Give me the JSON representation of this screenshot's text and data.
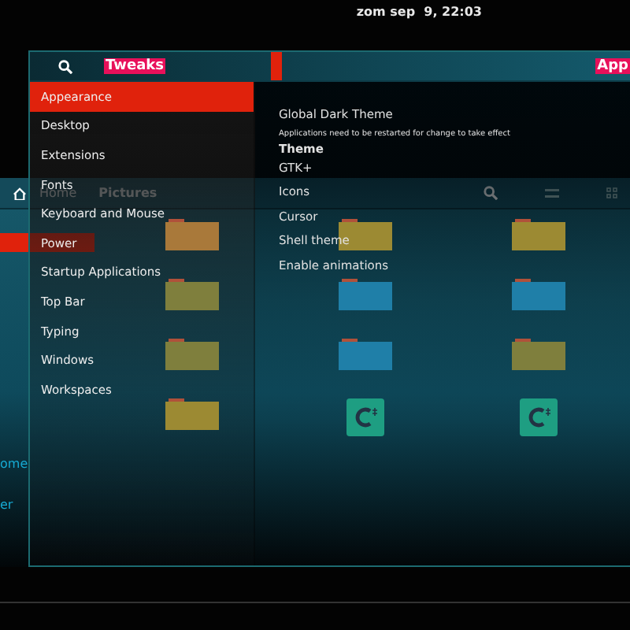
{
  "top_bar": {
    "clock": "zom sep  9, 22:03"
  },
  "files_window": {
    "path": [
      {
        "label": "Home",
        "selected": false
      },
      {
        "label": "Pictures",
        "selected": true
      }
    ],
    "sidebar": {
      "items": [
        {
          "selected": true
        },
        {
          "label": "ome",
          "selected": false
        },
        {
          "label": "er",
          "selected": false
        }
      ]
    },
    "items": [
      {
        "kind": "folder",
        "color": "#a9793a"
      },
      {
        "kind": "folder",
        "color": "#9c8a33"
      },
      {
        "kind": "folder",
        "color": "#9c8a33"
      },
      {
        "kind": "folder",
        "color": "#7f7f3d"
      },
      {
        "kind": "folder",
        "color": "#1f7fa8"
      },
      {
        "kind": "folder",
        "color": "#1f7fa8"
      },
      {
        "kind": "folder",
        "color": "#7f7f3d"
      },
      {
        "kind": "folder",
        "color": "#1f7fa8"
      },
      {
        "kind": "folder",
        "color": "#7f7f3d"
      },
      {
        "kind": "folder",
        "color": "#9c8a33"
      },
      {
        "kind": "app",
        "color": "#1e9e82"
      },
      {
        "kind": "app",
        "color": "#1e9e82"
      }
    ]
  },
  "tweaks_window": {
    "title": "Tweaks",
    "panel_title": "App",
    "sidebar": [
      {
        "label": "Appearance",
        "selected": true
      },
      {
        "label": "Desktop",
        "selected": false
      },
      {
        "label": "Extensions",
        "selected": false
      },
      {
        "label": "Fonts",
        "selected": false
      },
      {
        "label": "Keyboard and Mouse",
        "selected": false
      },
      {
        "label": "Power",
        "selected": false
      },
      {
        "label": "Startup Applications",
        "selected": false
      },
      {
        "label": "Top Bar",
        "selected": false
      },
      {
        "label": "Typing",
        "selected": false
      },
      {
        "label": "Windows",
        "selected": false
      },
      {
        "label": "Workspaces",
        "selected": false
      }
    ],
    "settings": [
      {
        "kind": "label",
        "text": "Global Dark Theme"
      },
      {
        "kind": "note",
        "text": "Applications need to be restarted for change to take effect"
      },
      {
        "kind": "heading",
        "text": "Theme"
      },
      {
        "kind": "label",
        "text": "GTK+"
      },
      {
        "kind": "label",
        "text": "Icons"
      },
      {
        "kind": "label",
        "text": "Cursor"
      },
      {
        "kind": "label",
        "text": "Shell theme"
      },
      {
        "kind": "label",
        "text": "Enable animations"
      }
    ]
  }
}
